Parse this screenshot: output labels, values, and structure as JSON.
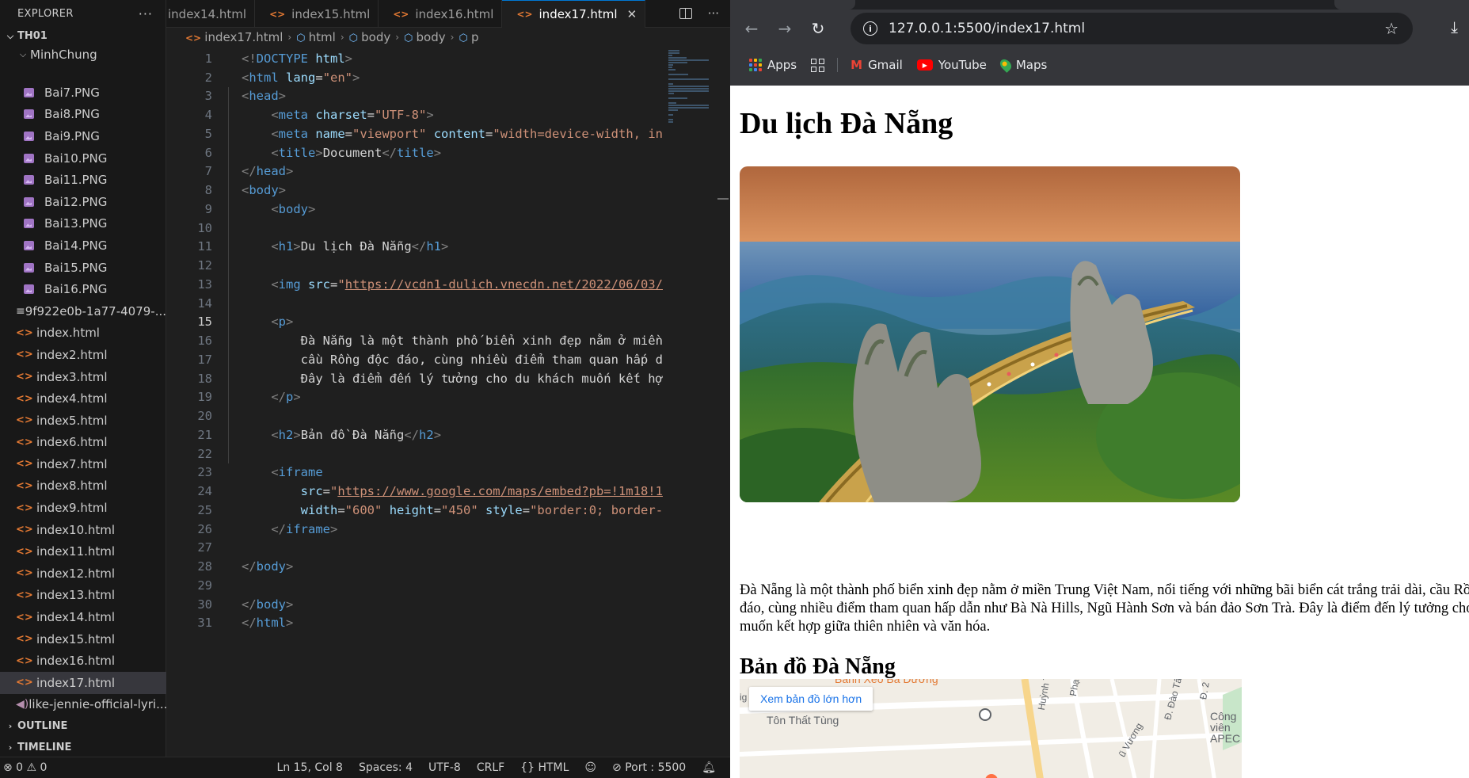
{
  "explorer": {
    "title": "EXPLORER",
    "more": "···",
    "workspace": "TH01",
    "folder": "MinhChung",
    "files": [
      {
        "name": "Bai7.PNG",
        "kind": "png"
      },
      {
        "name": "Bai8.PNG",
        "kind": "png"
      },
      {
        "name": "Bai9.PNG",
        "kind": "png"
      },
      {
        "name": "Bai10.PNG",
        "kind": "png"
      },
      {
        "name": "Bai11.PNG",
        "kind": "png"
      },
      {
        "name": "Bai12.PNG",
        "kind": "png"
      },
      {
        "name": "Bai13.PNG",
        "kind": "png"
      },
      {
        "name": "Bai14.PNG",
        "kind": "png"
      },
      {
        "name": "Bai15.PNG",
        "kind": "png"
      },
      {
        "name": "Bai16.PNG",
        "kind": "png"
      },
      {
        "name": "9f922e0b-1a77-4079-...",
        "kind": "txt"
      },
      {
        "name": "index.html",
        "kind": "html"
      },
      {
        "name": "index2.html",
        "kind": "html"
      },
      {
        "name": "index3.html",
        "kind": "html"
      },
      {
        "name": "index4.html",
        "kind": "html"
      },
      {
        "name": "index5.html",
        "kind": "html"
      },
      {
        "name": "index6.html",
        "kind": "html"
      },
      {
        "name": "index7.html",
        "kind": "html"
      },
      {
        "name": "index8.html",
        "kind": "html"
      },
      {
        "name": "index9.html",
        "kind": "html"
      },
      {
        "name": "index10.html",
        "kind": "html"
      },
      {
        "name": "index11.html",
        "kind": "html"
      },
      {
        "name": "index12.html",
        "kind": "html"
      },
      {
        "name": "index13.html",
        "kind": "html"
      },
      {
        "name": "index14.html",
        "kind": "html"
      },
      {
        "name": "index15.html",
        "kind": "html"
      },
      {
        "name": "index16.html",
        "kind": "html"
      },
      {
        "name": "index17.html",
        "kind": "html",
        "active": true
      },
      {
        "name": "like-jennie-official-lyri...",
        "kind": "audio"
      }
    ],
    "outline": "OUTLINE",
    "timeline": "TIMELINE"
  },
  "editor": {
    "tabs": [
      {
        "label": "index14.html",
        "active": false
      },
      {
        "label": "index15.html",
        "active": false
      },
      {
        "label": "index16.html",
        "active": false
      },
      {
        "label": "index17.html",
        "active": true
      }
    ],
    "breadcrumb": [
      "index17.html",
      "html",
      "body",
      "body",
      "p"
    ],
    "current_line": 15,
    "lines": [
      [
        [
          "tg",
          "<!"
        ],
        [
          "tn",
          "DOCTYPE"
        ],
        [
          "tx",
          " "
        ],
        [
          "an",
          "html"
        ],
        [
          "tg",
          ">"
        ]
      ],
      [
        [
          "tg",
          "<"
        ],
        [
          "tn",
          "html"
        ],
        [
          "tx",
          " "
        ],
        [
          "an",
          "lang"
        ],
        [
          "tx",
          "="
        ],
        [
          "av",
          "\"en\""
        ],
        [
          "tg",
          ">"
        ]
      ],
      [
        [
          "tg",
          "<"
        ],
        [
          "tn",
          "head"
        ],
        [
          "tg",
          ">"
        ]
      ],
      [
        [
          "tx",
          "    "
        ],
        [
          "tg",
          "<"
        ],
        [
          "tn",
          "meta"
        ],
        [
          "tx",
          " "
        ],
        [
          "an",
          "charset"
        ],
        [
          "tx",
          "="
        ],
        [
          "av",
          "\"UTF-8\""
        ],
        [
          "tg",
          ">"
        ]
      ],
      [
        [
          "tx",
          "    "
        ],
        [
          "tg",
          "<"
        ],
        [
          "tn",
          "meta"
        ],
        [
          "tx",
          " "
        ],
        [
          "an",
          "name"
        ],
        [
          "tx",
          "="
        ],
        [
          "av",
          "\"viewport\""
        ],
        [
          "tx",
          " "
        ],
        [
          "an",
          "content"
        ],
        [
          "tx",
          "="
        ],
        [
          "av",
          "\"width=device-width, in"
        ]
      ],
      [
        [
          "tx",
          "    "
        ],
        [
          "tg",
          "<"
        ],
        [
          "tn",
          "title"
        ],
        [
          "tg",
          ">"
        ],
        [
          "tx",
          "Document"
        ],
        [
          "tg",
          "</"
        ],
        [
          "tn",
          "title"
        ],
        [
          "tg",
          ">"
        ]
      ],
      [
        [
          "tg",
          "</"
        ],
        [
          "tn",
          "head"
        ],
        [
          "tg",
          ">"
        ]
      ],
      [
        [
          "tg",
          "<"
        ],
        [
          "tn",
          "body"
        ],
        [
          "tg",
          ">"
        ]
      ],
      [
        [
          "tx",
          "    "
        ],
        [
          "tg",
          "<"
        ],
        [
          "tn",
          "body"
        ],
        [
          "tg",
          ">"
        ]
      ],
      [],
      [
        [
          "tx",
          "    "
        ],
        [
          "tg",
          "<"
        ],
        [
          "tn",
          "h1"
        ],
        [
          "tg",
          ">"
        ],
        [
          "tx",
          "Du lịch Đà Nẵng"
        ],
        [
          "tg",
          "</"
        ],
        [
          "tn",
          "h1"
        ],
        [
          "tg",
          ">"
        ]
      ],
      [],
      [
        [
          "tx",
          "    "
        ],
        [
          "tg",
          "<"
        ],
        [
          "tn",
          "img"
        ],
        [
          "tx",
          " "
        ],
        [
          "an",
          "src"
        ],
        [
          "tx",
          "="
        ],
        [
          "av",
          "\""
        ],
        [
          "avu",
          "https://vcdn1-dulich.vnecdn.net/2022/06/03/"
        ]
      ],
      [],
      [
        [
          "tx",
          "    "
        ],
        [
          "tg",
          "<"
        ],
        [
          "tn",
          "p"
        ],
        [
          "tg",
          ">"
        ]
      ],
      [
        [
          "tx",
          "        Đà Nẵng là một thành phố biển xinh đẹp nằm ở miền"
        ]
      ],
      [
        [
          "tx",
          "        cầu Rồng độc đáo, cùng nhiều điểm tham quan hấp d"
        ]
      ],
      [
        [
          "tx",
          "        Đây là điểm đến lý tưởng cho du khách muốn kết hợ"
        ]
      ],
      [
        [
          "tx",
          "    "
        ],
        [
          "tg",
          "</"
        ],
        [
          "tn",
          "p"
        ],
        [
          "tg",
          ">"
        ]
      ],
      [],
      [
        [
          "tx",
          "    "
        ],
        [
          "tg",
          "<"
        ],
        [
          "tn",
          "h2"
        ],
        [
          "tg",
          ">"
        ],
        [
          "tx",
          "Bản đồ Đà Nẵng"
        ],
        [
          "tg",
          "</"
        ],
        [
          "tn",
          "h2"
        ],
        [
          "tg",
          ">"
        ]
      ],
      [],
      [
        [
          "tx",
          "    "
        ],
        [
          "tg",
          "<"
        ],
        [
          "tn",
          "iframe"
        ]
      ],
      [
        [
          "tx",
          "        "
        ],
        [
          "an",
          "src"
        ],
        [
          "tx",
          "="
        ],
        [
          "av",
          "\""
        ],
        [
          "avu",
          "https://www.google.com/maps/embed?pb=!1m18!1"
        ]
      ],
      [
        [
          "tx",
          "        "
        ],
        [
          "an",
          "width"
        ],
        [
          "tx",
          "="
        ],
        [
          "av",
          "\"600\""
        ],
        [
          "tx",
          " "
        ],
        [
          "an",
          "height"
        ],
        [
          "tx",
          "="
        ],
        [
          "av",
          "\"450\""
        ],
        [
          "tx",
          " "
        ],
        [
          "an",
          "style"
        ],
        [
          "tx",
          "="
        ],
        [
          "av",
          "\"border:0; border-"
        ]
      ],
      [
        [
          "tx",
          "    "
        ],
        [
          "tg",
          "</"
        ],
        [
          "tn",
          "iframe"
        ],
        [
          "tg",
          ">"
        ]
      ],
      [],
      [
        [
          "tg",
          "</"
        ],
        [
          "tn",
          "body"
        ],
        [
          "tg",
          ">"
        ]
      ],
      [],
      [
        [
          "tg",
          "</"
        ],
        [
          "tn",
          "body"
        ],
        [
          "tg",
          ">"
        ]
      ],
      [
        [
          "tg",
          "</"
        ],
        [
          "tn",
          "html"
        ],
        [
          "tg",
          ">"
        ]
      ]
    ]
  },
  "statusbar": {
    "problems": "⊗ 0 ⚠ 0",
    "position": "Ln 15, Col 8",
    "spaces": "Spaces: 4",
    "encoding": "UTF-8",
    "eol": "CRLF",
    "language": "HTML",
    "port": "Port : 5500"
  },
  "browser": {
    "url": "127.0.0.1:5500/index17.html",
    "bookmarks": {
      "apps": "Apps",
      "gmail": "Gmail",
      "youtube": "YouTube",
      "maps": "Maps"
    },
    "page": {
      "h1": "Du lịch Đà Nẵng",
      "paragraph": "Đà Nẵng là một thành phố biển xinh đẹp nằm ở miền Trung Việt Nam, nổi tiếng với những bãi biển cát trắng trải dài, cầu Rồng độc đáo, cùng nhiều điểm tham quan hấp dẫn như Bà Nà Hills, Ngũ Hành Sơn và bán đảo Sơn Trà. Đây là điểm đến lý tưởng cho du khách muốn kết hợp giữa thiên nhiên và văn hóa.",
      "h2": "Bản đồ Đà Nẵng",
      "map": {
        "button": "Xem bản đồ lớn hơn",
        "labels": [
          "Tôn Thất Tùng",
          "Công viên APEC",
          "Bánh Xèo Bà Dưỡng",
          "Huỳnh T",
          "Phạ",
          "Đ. Đào Tấ",
          "Đ. 2",
          "ũ Vương",
          "ig"
        ]
      }
    }
  },
  "colors": {
    "accent": "#0078d4",
    "html_icon": "#e37933",
    "png_icon": "#a074c4"
  }
}
